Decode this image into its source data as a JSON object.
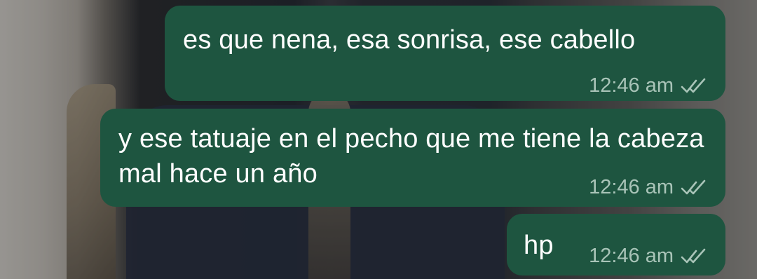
{
  "messages": [
    {
      "text": "es que nena, esa sonrisa, ese cabello",
      "time": "12:46 am",
      "status_icon": "double-check-icon"
    },
    {
      "text": "y ese tatuaje en el pecho que me tiene la cabeza mal hace un año",
      "time": "12:46 am",
      "status_icon": "double-check-icon"
    },
    {
      "text": "hp",
      "time": "12:46 am",
      "status_icon": "double-check-icon"
    }
  ],
  "colors": {
    "bubble": "#1e5540",
    "text": "#ffffff",
    "meta": "#a9c4b8"
  }
}
